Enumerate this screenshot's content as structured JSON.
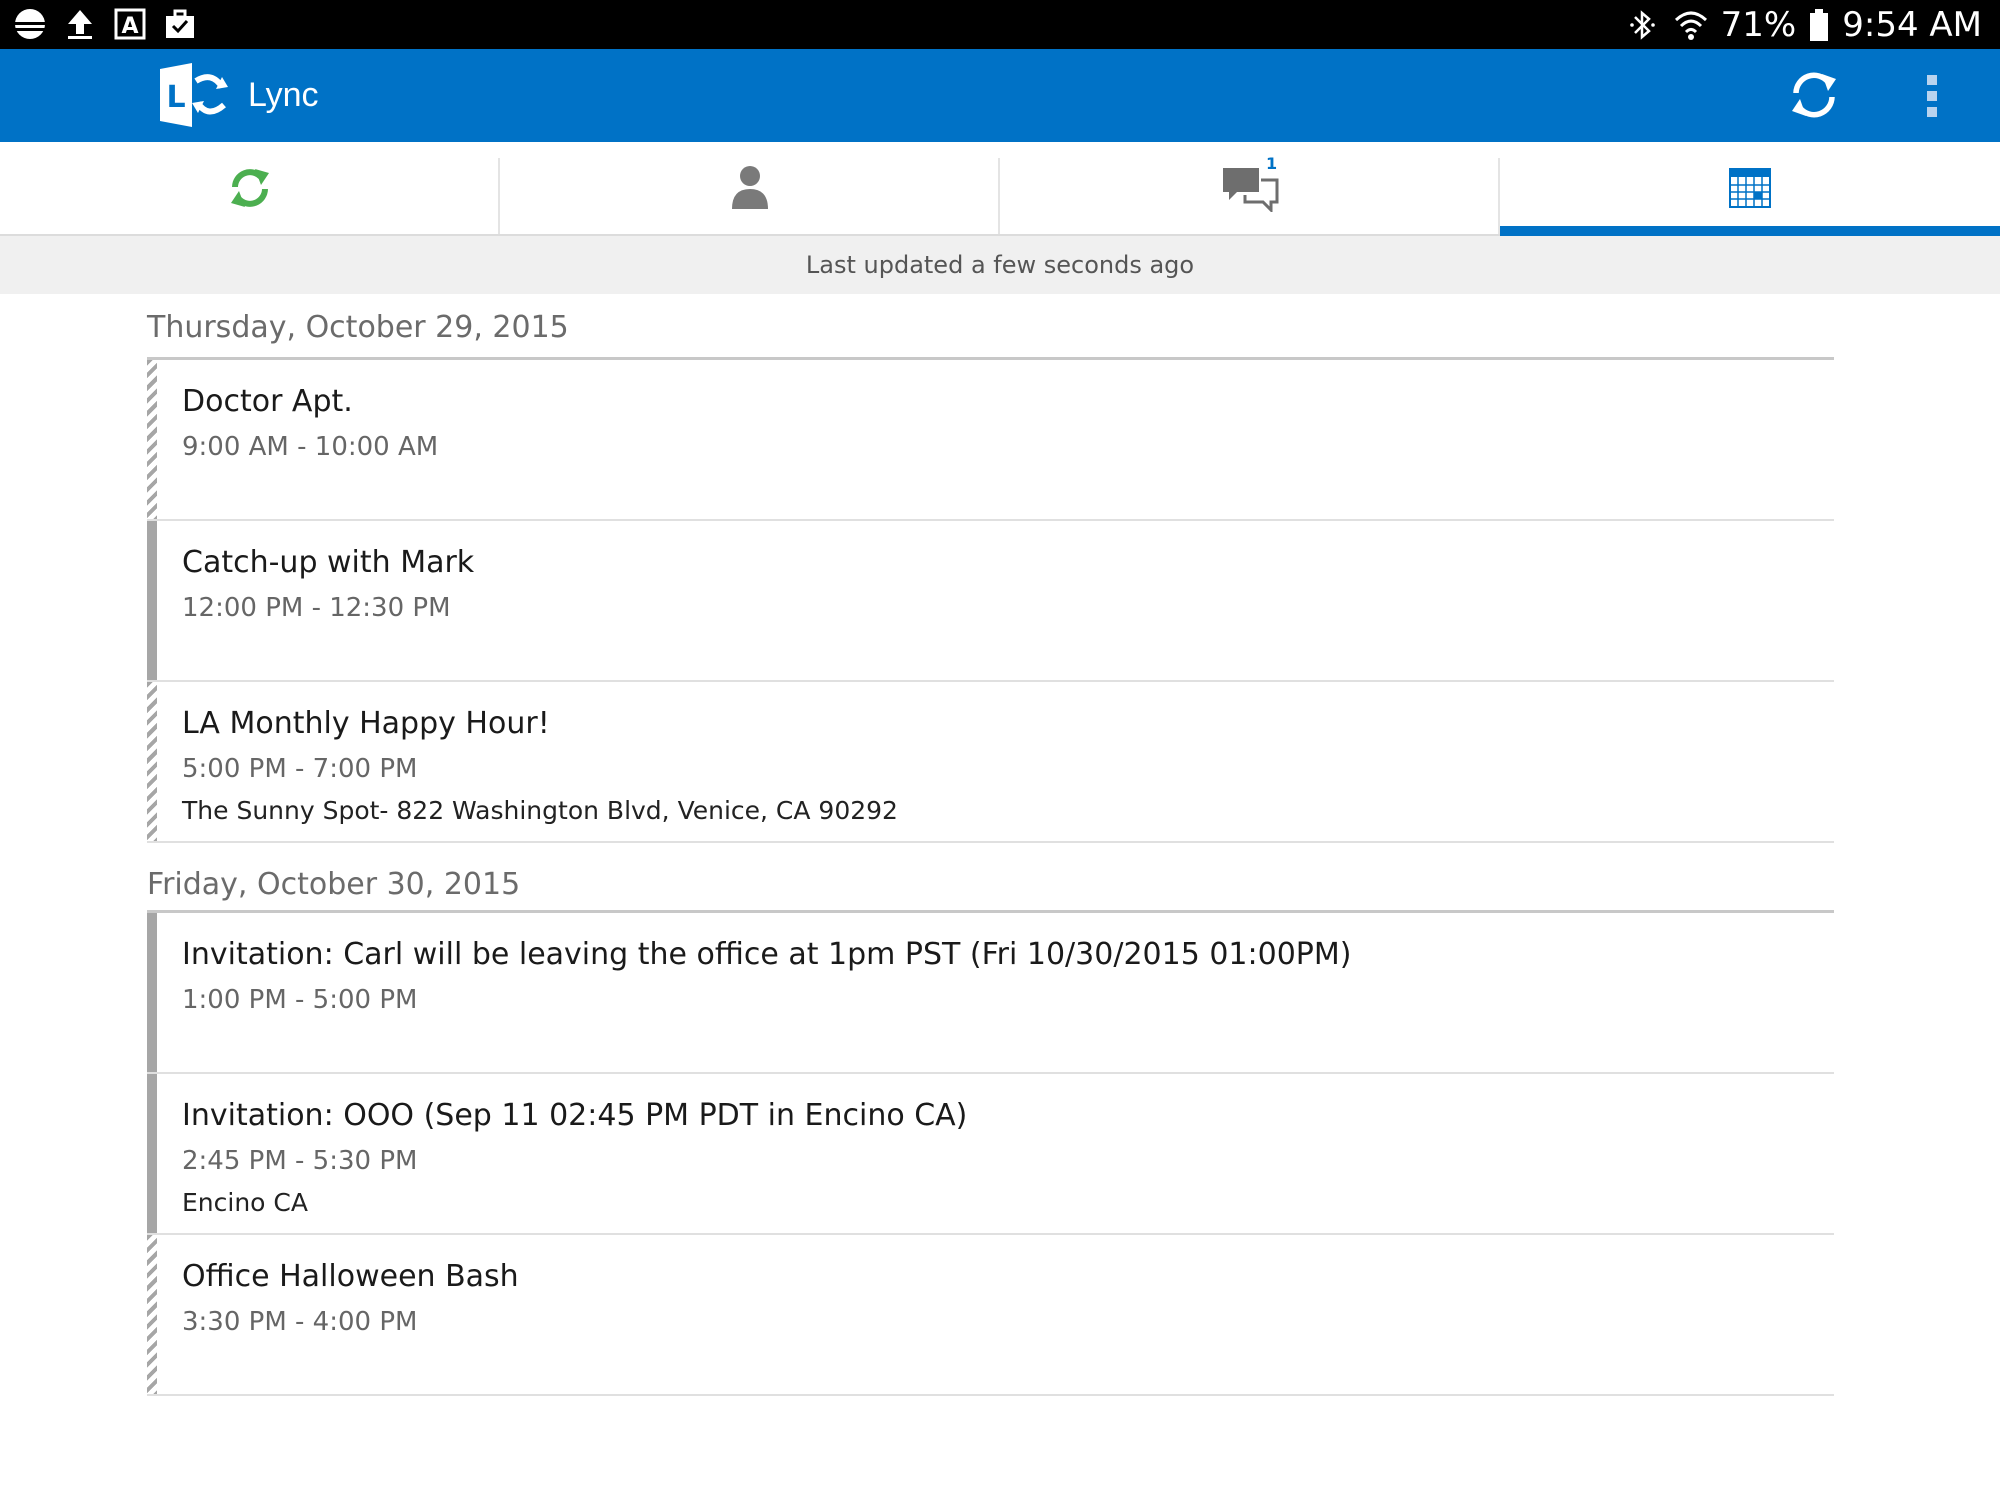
{
  "status_bar": {
    "battery": "71%",
    "time": "9:54 AM",
    "left_icons": [
      "weather-icon",
      "upload-icon",
      "text-icon",
      "briefcase-icon"
    ],
    "right_icons": [
      "bluetooth-icon",
      "wifi-icon",
      "battery-icon"
    ]
  },
  "app": {
    "title": "Lync",
    "brand_color": "#0072c6"
  },
  "tabs": [
    {
      "name": "activity",
      "icon": "sync-icon"
    },
    {
      "name": "contacts",
      "icon": "person-icon"
    },
    {
      "name": "conversations",
      "icon": "chat-icon",
      "badge": "1"
    },
    {
      "name": "meetings",
      "icon": "calendar-icon",
      "selected": true
    }
  ],
  "update_status": "Last updated a few seconds ago",
  "days": [
    {
      "date": "Thursday, October 29, 2015",
      "events": [
        {
          "title": "Doctor Apt.",
          "time": "9:00 AM - 10:00 AM",
          "location": "",
          "status": "tentative"
        },
        {
          "title": "Catch-up with Mark",
          "time": "12:00 PM - 12:30 PM",
          "location": "",
          "status": "busy"
        },
        {
          "title": "LA Monthly Happy Hour!",
          "time": "5:00 PM - 7:00 PM",
          "location": "The Sunny Spot- 822 Washington Blvd, Venice, CA 90292",
          "status": "tentative"
        }
      ]
    },
    {
      "date": "Friday, October 30, 2015",
      "events": [
        {
          "title": "Invitation: Carl will be leaving the office at 1pm PST  (Fri 10/30/2015 01:00PM)",
          "time": "1:00 PM - 5:00 PM",
          "location": "",
          "status": "busy"
        },
        {
          "title": "Invitation: OOO  (Sep 11 02:45 PM PDT in Encino CA)",
          "time": "2:45 PM - 5:30 PM",
          "location": "Encino CA",
          "status": "busy"
        },
        {
          "title": "Office Halloween Bash",
          "time": "3:30 PM - 4:00 PM",
          "location": "",
          "status": "tentative"
        }
      ]
    }
  ]
}
